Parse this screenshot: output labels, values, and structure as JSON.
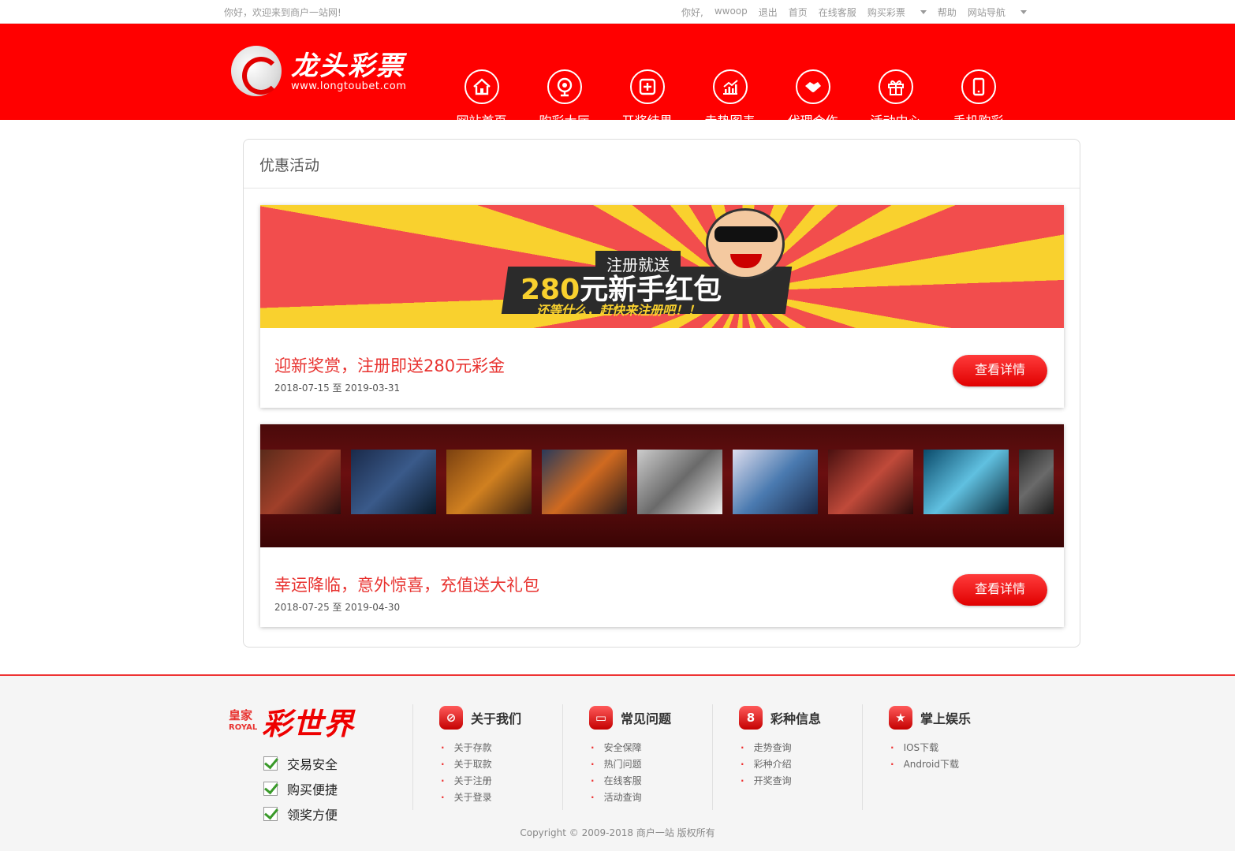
{
  "topbar": {
    "welcome": "你好，欢迎来到商户一站网!",
    "hello": "你好,",
    "username": "wwoop",
    "logout": "退出",
    "home": "首页",
    "service": "在线客服",
    "buy": "购买彩票",
    "help": "帮助",
    "sitenav": "网站导航"
  },
  "header": {
    "logo_cn": "龙头彩票",
    "logo_url": "www.longtoubet.com",
    "nav": [
      {
        "label": "网站首页",
        "icon": "home-icon"
      },
      {
        "label": "购彩大厅",
        "icon": "webcam-icon"
      },
      {
        "label": "开奖结果",
        "icon": "dice-icon"
      },
      {
        "label": "走势图表",
        "icon": "chart-icon"
      },
      {
        "label": "代理合作",
        "icon": "handshake-icon"
      },
      {
        "label": "活动中心",
        "icon": "gift-icon"
      },
      {
        "label": "手机购彩",
        "icon": "mobile-icon"
      }
    ]
  },
  "panel": {
    "title": "优惠活动",
    "promos": [
      {
        "banner_top": "注册就送",
        "banner_num": "280",
        "banner_main": "元新手红包",
        "banner_sub": "还等什么，赶快来注册吧！！",
        "title": "迎新奖赏，注册即送280元彩金",
        "date": "2018-07-15 至 2019-03-31",
        "button": "查看详情"
      },
      {
        "title": "幸运降临，意外惊喜，充值送大礼包",
        "date": "2018-07-25 至 2019-04-30",
        "button": "查看详情"
      }
    ]
  },
  "footer": {
    "brand_small_1": "皇家",
    "brand_small_2": "ROYAL",
    "brand_large": "彩世界",
    "checks": [
      "交易安全",
      "购买便捷",
      "领奖方便"
    ],
    "columns": [
      {
        "title": "关于我们",
        "icon": "compass-icon",
        "items": [
          "关于存款",
          "关于取款",
          "关于注册",
          "关于登录"
        ]
      },
      {
        "title": "常见问题",
        "icon": "card-icon",
        "items": [
          "安全保障",
          "热门问题",
          "在线客服",
          "活动查询"
        ]
      },
      {
        "title": "彩种信息",
        "icon": "ball-icon",
        "items": [
          "走势查询",
          "彩种介绍",
          "开奖查询"
        ]
      },
      {
        "title": "掌上娱乐",
        "icon": "star-icon",
        "items": [
          "IOS下载",
          "Android下载"
        ]
      }
    ],
    "copyright": "Copyright © 2009-2018 商户一站 版权所有"
  }
}
